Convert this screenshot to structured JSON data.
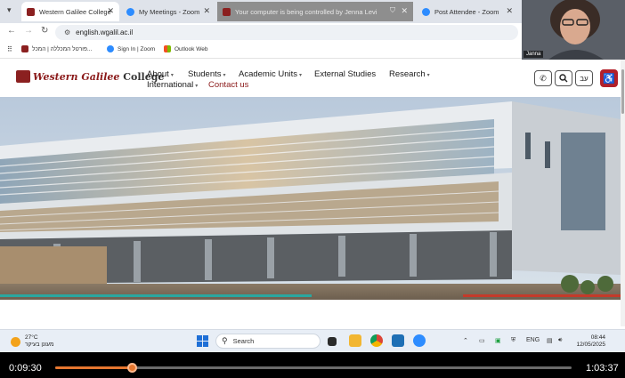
{
  "browser": {
    "tabs": [
      {
        "label": "Western Galilee College",
        "active": true,
        "color": "#8b2020"
      },
      {
        "label": "My Meetings - Zoom",
        "active": false,
        "color": "#2d8cff"
      },
      {
        "label": "Your computer is being controlled by Jenna Levi",
        "active": false,
        "color": "#8b2020"
      },
      {
        "label": "Post Attendee - Zoom",
        "active": false,
        "color": "#2d8cff"
      }
    ],
    "url": "english.wgalil.ac.il",
    "bookmarks": [
      {
        "label": "פורטל המכללה | המכל..."
      },
      {
        "label": "Sign In | Zoom"
      },
      {
        "label": "Outlook Web"
      }
    ]
  },
  "site": {
    "logo_script": "Western Galilee",
    "logo_bold": "College",
    "nav": {
      "about": "About",
      "students": "Students",
      "academic": "Academic Units",
      "external": "External Studies",
      "research": "Research",
      "international": "International",
      "contact": "Contact us"
    },
    "lang_button": "עב",
    "accent_color": "#8b1a1a"
  },
  "taskbar": {
    "temperature": "27°C",
    "weather_text": "מעונן בעיקר",
    "search_placeholder": "Search",
    "language": "ENG",
    "time": "08:44",
    "date": "12/05/2025"
  },
  "webcam": {
    "participant": "Janna"
  },
  "video": {
    "elapsed": "0:09:30",
    "duration": "1:03:37",
    "progress": 0.149
  }
}
